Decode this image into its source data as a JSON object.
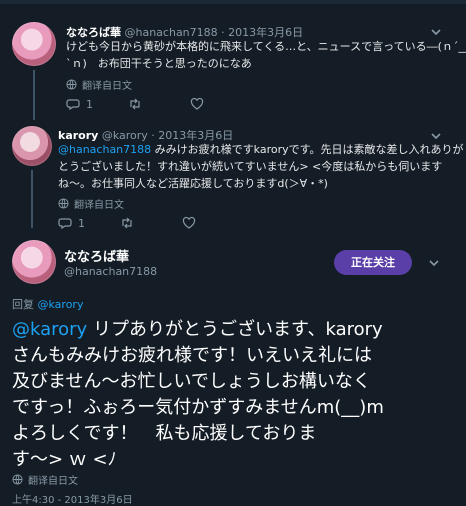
{
  "tweets": [
    {
      "display_name": "ななろば華",
      "handle": "@hanachan7188",
      "date": "· 2013年3月6日",
      "text_line1": "けども今日から黄砂が本格的に飛来してくる…と、ニュースで言っている―(ｎ´__",
      "text_line2": "`ｎ)　お布団干そうと思ったのになあ",
      "translate_label": "翻译自日文",
      "reply_count": "1",
      "retweet_count": "",
      "like_count": ""
    },
    {
      "display_name": "karory",
      "handle": "@karory",
      "date": "· 2013年3月6日",
      "mention": "@hanachan7188",
      "text_line1_rest": " みみけお疲れ様ですkaroryです。先日は素敵な差し入れありが",
      "text_line2": "とうございました！すれ違いが続いてすいません> <今度は私からも伺います",
      "text_line3": "ね～。お仕事同人など活躍応援しておりますd(＞∀・*)",
      "translate_label": "翻译自日文",
      "reply_count": "1",
      "retweet_count": "",
      "like_count": ""
    }
  ],
  "main_tweet": {
    "display_name": "ななろば華",
    "handle": "@hanachan7188",
    "follow_label": "正在关注",
    "reply_to_label": "回复",
    "reply_to_handle": "@karory",
    "mention": "@karory",
    "text_line1_rest": " リプありがとうございます、karory",
    "text_line2": "さんもみみけお疲れ様です！いえいえ礼には",
    "text_line3": "及びません～お忙しいでしょうしお構いなく",
    "text_line4": "ですっ！ふぉろー気付かずすみませんm(__)m",
    "text_line5": "よろしくです！　私も応援しておりま",
    "text_line6": "す～> ｗ <ﾉ",
    "translate_label": "翻译自日文",
    "timestamp": "上午4:30 - 2013年3月6日"
  },
  "icons": [
    "chevron-down-icon",
    "globe-icon",
    "reply-icon",
    "retweet-icon",
    "heart-icon"
  ],
  "colors": {
    "background": "#141d26",
    "accent": "#1da1f2",
    "follow_button": "#5a3fa8",
    "muted": "#8899a6"
  }
}
